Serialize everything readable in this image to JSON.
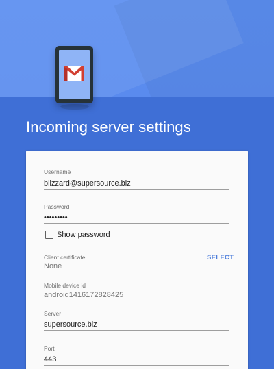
{
  "page": {
    "title": "Incoming server settings"
  },
  "form": {
    "username": {
      "label": "Username",
      "value": "blizzard@supersource.biz"
    },
    "password": {
      "label": "Password",
      "value": "•••••••••"
    },
    "show_password": {
      "label": "Show password",
      "checked": false
    },
    "client_certificate": {
      "label": "Client certificate",
      "value": "None",
      "action": "SELECT"
    },
    "mobile_device_id": {
      "label": "Mobile device id",
      "value": "android1416172828425"
    },
    "server": {
      "label": "Server",
      "value": "supersource.biz"
    },
    "port": {
      "label": "Port",
      "value": "443"
    }
  },
  "colors": {
    "background": "#3f6fd6",
    "hero": "#5a8bee",
    "accent": "#4c7ddb",
    "card": "#fafafa"
  },
  "icons": {
    "hero": "gmail-icon",
    "device": "phone-icon"
  }
}
